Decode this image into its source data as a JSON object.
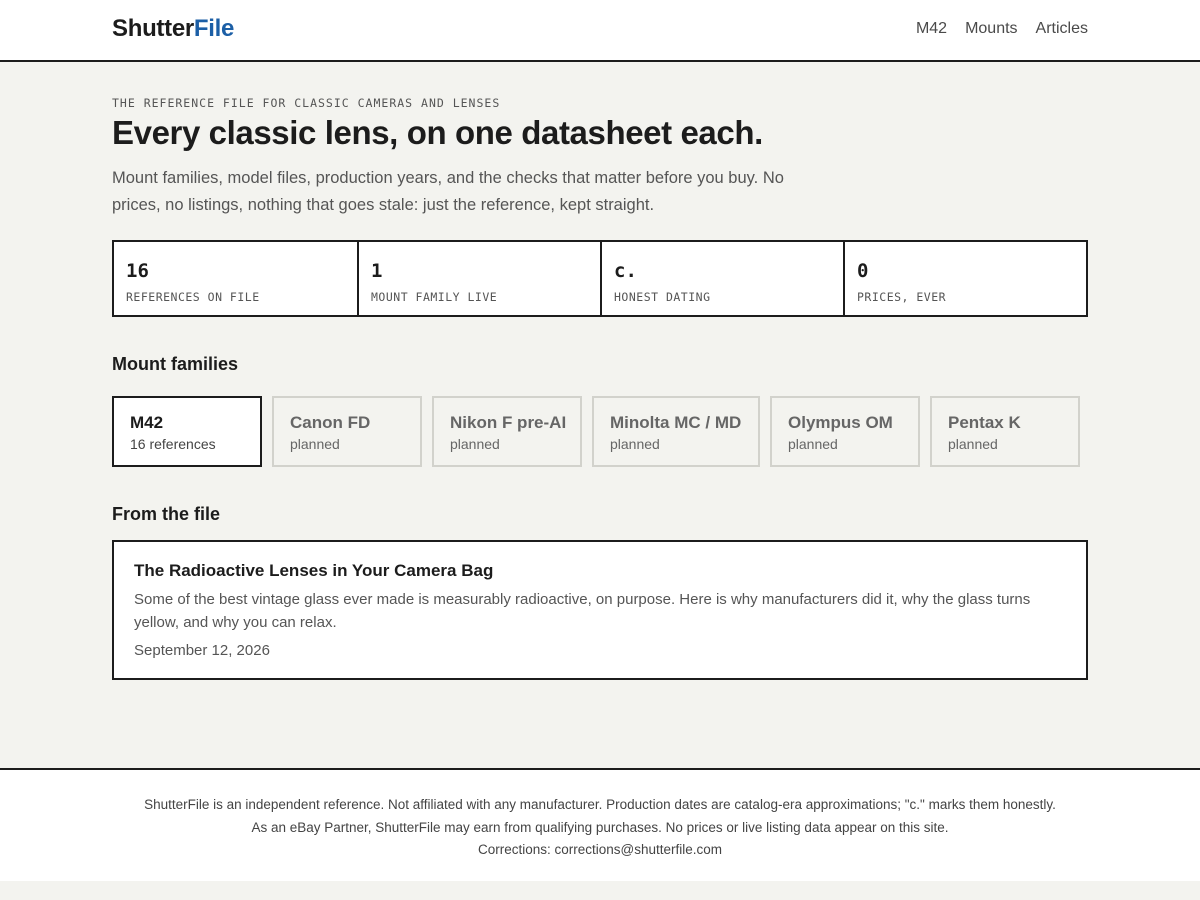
{
  "header": {
    "logo_part1": "Shutter",
    "logo_part2": "File",
    "nav": [
      "M42",
      "Mounts",
      "Articles"
    ]
  },
  "hero": {
    "eyebrow": "THE REFERENCE FILE FOR CLASSIC CAMERAS AND LENSES",
    "title": "Every classic lens, on one datasheet each.",
    "subtitle": "Mount families, model files, production years, and the checks that matter before you buy. No prices, no listings, nothing that goes stale: just the reference, kept straight."
  },
  "stats": [
    {
      "value": "16",
      "label": "REFERENCES ON FILE"
    },
    {
      "value": "1",
      "label": "MOUNT FAMILY LIVE"
    },
    {
      "value": "c.",
      "label": "HONEST DATING"
    },
    {
      "value": "0",
      "label": "PRICES, EVER"
    }
  ],
  "mounts": {
    "title": "Mount families",
    "items": [
      {
        "name": "M42",
        "meta": "16 references",
        "active": true
      },
      {
        "name": "Canon FD",
        "meta": "planned",
        "active": false
      },
      {
        "name": "Nikon F pre-AI",
        "meta": "planned",
        "active": false
      },
      {
        "name": "Minolta MC / MD",
        "meta": "planned",
        "active": false
      },
      {
        "name": "Olympus OM",
        "meta": "planned",
        "active": false
      },
      {
        "name": "Pentax K",
        "meta": "planned",
        "active": false
      }
    ]
  },
  "articles": {
    "title": "From the file",
    "items": [
      {
        "title": "The Radioactive Lenses in Your Camera Bag",
        "excerpt": "Some of the best vintage glass ever made is measurably radioactive, on purpose. Here is why manufacturers did it, why the glass turns yellow, and why you can relax.",
        "date": "September 12, 2026"
      }
    ]
  },
  "footer": {
    "line1": "ShutterFile is an independent reference. Not affiliated with any manufacturer. Production dates are catalog-era approximations; \"c.\" marks them honestly.",
    "line2": "As an eBay Partner, ShutterFile may earn from qualifying purchases. No prices or live listing data appear on this site.",
    "line3": "Corrections: corrections@shutterfile.com"
  },
  "colors": {
    "background": "#f3f3ef",
    "ink": "#1c1c1c",
    "accent": "#1c5fa6"
  }
}
